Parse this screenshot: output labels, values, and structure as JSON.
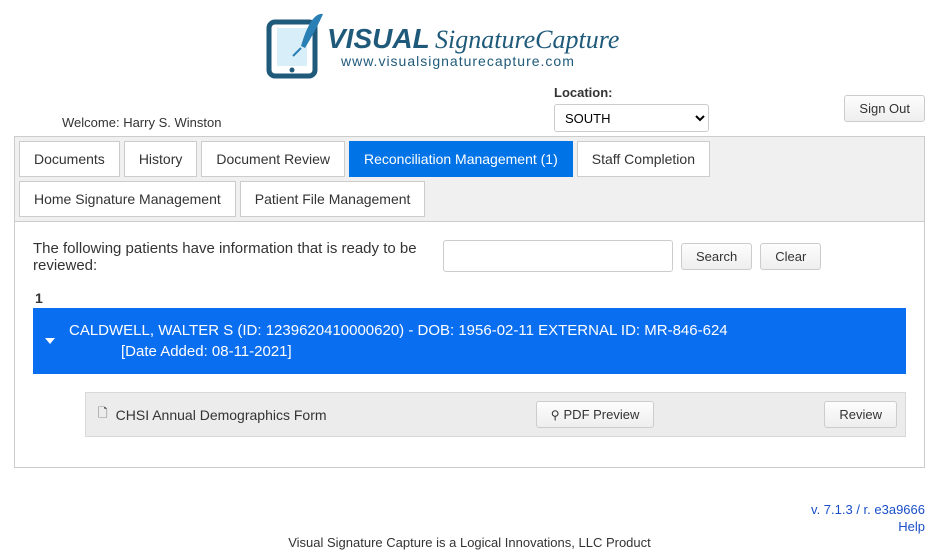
{
  "logo": {
    "main": "VISUAL",
    "rest": "SignatureCapture",
    "url": "www.visualsignaturecapture.com"
  },
  "header": {
    "welcome_label": "Welcome:",
    "welcome_user": "Harry S. Winston",
    "location_label": "Location:",
    "location_value": "SOUTH",
    "signout": "Sign Out"
  },
  "tabs": {
    "documents": "Documents",
    "history": "History",
    "doc_review": "Document Review",
    "reconciliation": "Reconciliation Management (1)",
    "staff_completion": "Staff Completion",
    "home_sig": "Home Signature Management",
    "patient_file": "Patient File Management"
  },
  "content": {
    "intro_text": "The following patients have information that is ready to be reviewed:",
    "search_btn": "Search",
    "clear_btn": "Clear",
    "page_num": "1",
    "patient": {
      "line1": "CALDWELL, WALTER S (ID: 1239620410000620) - DOB: 1956-02-11 EXTERNAL ID: MR-846-624",
      "line2": "[Date Added: 08-11-2021]"
    },
    "document": {
      "name": "CHSI Annual Demographics Form",
      "pdf_preview": "PDF Preview",
      "review": "Review"
    }
  },
  "footer": {
    "version": "v. 7.1.3 / r. e3a9666",
    "help": "Help",
    "product": "Visual Signature Capture is a Logical Innovations, LLC Product"
  }
}
